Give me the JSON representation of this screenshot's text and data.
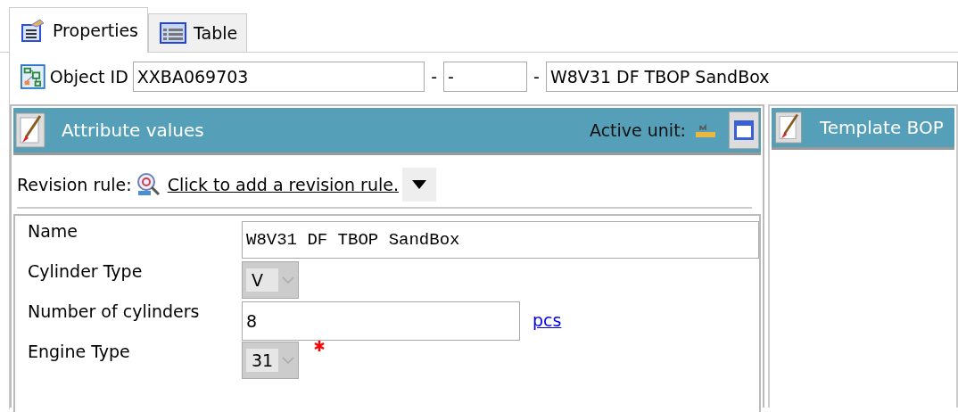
{
  "tabs": [
    {
      "label": "Properties",
      "kind": "properties",
      "selected": true
    },
    {
      "label": "Table",
      "kind": "table",
      "selected": false
    }
  ],
  "object_id": {
    "label": "Object ID",
    "id": "XXBA069703",
    "revision": "-",
    "name": "W8V31 DF TBOP SandBox",
    "separators": [
      "-",
      "-"
    ]
  },
  "attribute_panel": {
    "title": "Attribute values",
    "active_unit_label": "Active unit:",
    "revision_rule_label": "Revision rule:",
    "revision_rule_link": "Click to add a revision rule.",
    "attributes": [
      {
        "label": "Name",
        "kind": "wide",
        "value": "W8V31 DF TBOP SandBox",
        "required": false
      },
      {
        "label": "Cylinder Type",
        "kind": "combo",
        "value": "V",
        "required": false
      },
      {
        "label": "Number of cylinders",
        "kind": "text",
        "value": "8",
        "unit": "pcs",
        "required": false
      },
      {
        "label": "Engine Type",
        "kind": "combo",
        "value": "31",
        "required": true
      }
    ]
  },
  "template_panel": {
    "title": "Template BOP"
  }
}
